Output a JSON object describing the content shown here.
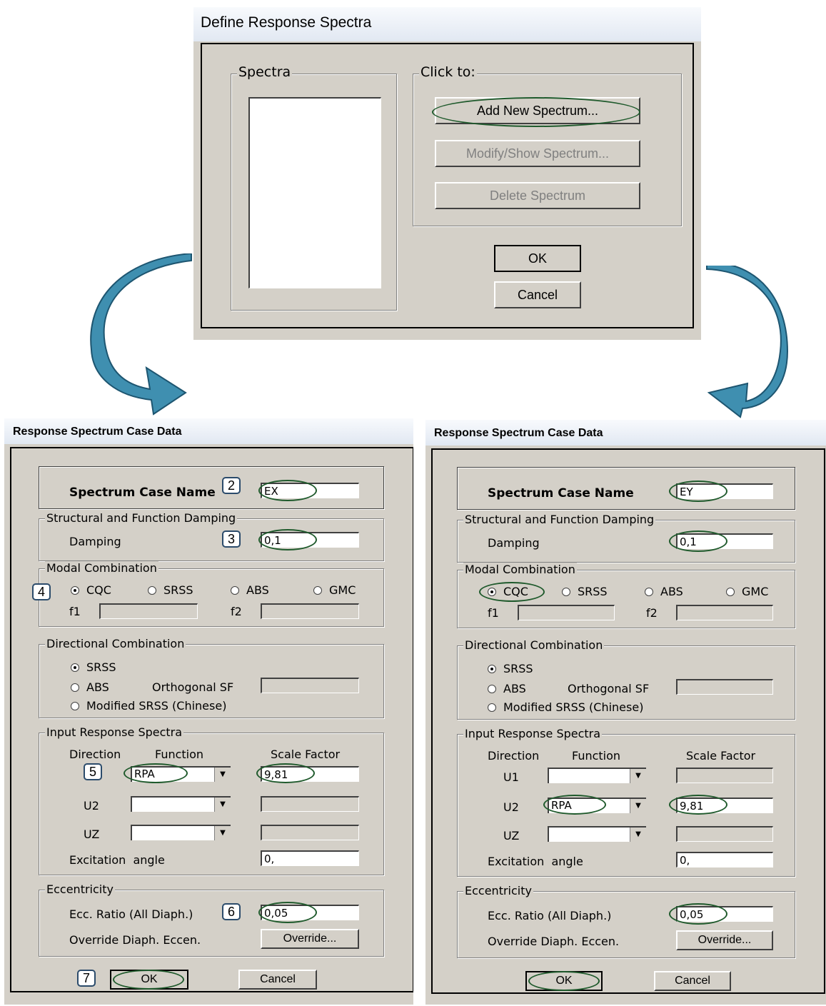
{
  "top_dialog": {
    "title": "Define Response Spectra",
    "spectra_group": "Spectra",
    "click_group": "Click to:",
    "add_button": "Add New Spectrum...",
    "modify_button": "Modify/Show Spectrum...",
    "delete_button": "Delete Spectrum",
    "ok_button": "OK",
    "cancel_button": "Cancel"
  },
  "left_dialog": {
    "title": "Response Spectrum Case Data",
    "case_name_label": "Spectrum Case Name",
    "case_name_value": "EX",
    "damping_group": "Structural and Function Damping",
    "damping_label": "Damping",
    "damping_value": "0,1",
    "modal_group": "Modal Combination",
    "modal_options": [
      "CQC",
      "SRSS",
      "ABS",
      "GMC"
    ],
    "f1_label": "f1",
    "f2_label": "f2",
    "directional_group": "Directional Combination",
    "dir_options": [
      "SRSS",
      "ABS",
      "Modified SRSS (Chinese)"
    ],
    "orthogonal_label": "Orthogonal SF",
    "input_group": "Input Response Spectra",
    "col_direction": "Direction",
    "col_function": "Function",
    "col_scale": "Scale Factor",
    "rows": [
      {
        "dir": "",
        "func": "RPA",
        "scale": "9,81"
      },
      {
        "dir": "U2",
        "func": "",
        "scale": ""
      },
      {
        "dir": "UZ",
        "func": "",
        "scale": ""
      }
    ],
    "excitation_label": "Excitation  angle",
    "excitation_value": "0,",
    "ecc_group": "Eccentricity",
    "ecc_label": "Ecc. Ratio (All Diaph.)",
    "ecc_value": "0,05",
    "override_label": "Override Diaph. Eccen.",
    "override_button": "Override...",
    "ok_button": "OK",
    "cancel_button": "Cancel",
    "steps": [
      "2",
      "3",
      "4",
      "5",
      "6",
      "7"
    ]
  },
  "right_dialog": {
    "title": "Response Spectrum Case Data",
    "case_name_label": "Spectrum Case Name",
    "case_name_value": "EY",
    "damping_group": "Structural and Function Damping",
    "damping_label": "Damping",
    "damping_value": "0,1",
    "modal_group": "Modal Combination",
    "modal_options": [
      "CQC",
      "SRSS",
      "ABS",
      "GMC"
    ],
    "f1_label": "f1",
    "f2_label": "f2",
    "directional_group": "Directional Combination",
    "dir_options": [
      "SRSS",
      "ABS",
      "Modified SRSS (Chinese)"
    ],
    "orthogonal_label": "Orthogonal SF",
    "input_group": "Input Response Spectra",
    "col_direction": "Direction",
    "col_function": "Function",
    "col_scale": "Scale Factor",
    "rows": [
      {
        "dir": "U1",
        "func": "",
        "scale": ""
      },
      {
        "dir": "U2",
        "func": "RPA",
        "scale": "9,81"
      },
      {
        "dir": "UZ",
        "func": "",
        "scale": ""
      }
    ],
    "excitation_label": "Excitation  angle",
    "excitation_value": "0,",
    "ecc_group": "Eccentricity",
    "ecc_label": "Ecc. Ratio (All Diaph.)",
    "ecc_value": "0,05",
    "override_label": "Override Diaph. Eccen.",
    "override_button": "Override...",
    "ok_button": "OK",
    "cancel_button": "Cancel"
  },
  "colors": {
    "arrow": "#3f8fb0",
    "highlight": "#1f5a2c",
    "dialog_bg": "#d4d0c8"
  },
  "icons": [
    "curved-arrow-left-icon",
    "curved-arrow-right-icon",
    "dropdown-arrow-icon"
  ]
}
